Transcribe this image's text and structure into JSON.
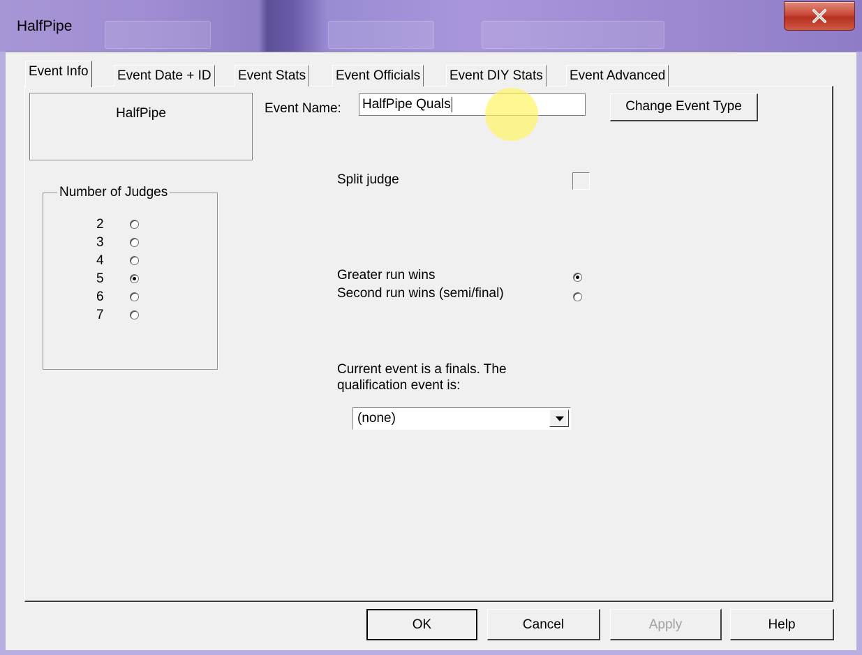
{
  "window": {
    "title": "HalfPipe",
    "close_glyph": "✕"
  },
  "tabs": [
    {
      "label": "Event Info",
      "active": true
    },
    {
      "label": "Event  Date + ID"
    },
    {
      "label": "Event  Stats"
    },
    {
      "label": "Event  Officials"
    },
    {
      "label": "Event DIY Stats"
    },
    {
      "label": "Event Advanced"
    }
  ],
  "event_type_box": {
    "label": "HalfPipe"
  },
  "event_name": {
    "label": "Event Name:",
    "value": "HalfPipe Quals"
  },
  "change_event_type_button": "Change Event Type",
  "number_of_judges": {
    "title": "Number of Judges",
    "options": [
      "2",
      "3",
      "4",
      "5",
      "6",
      "7"
    ],
    "selected": "5"
  },
  "split_judge": {
    "label": "Split judge",
    "checked": false
  },
  "run_rule": {
    "options": [
      "Greater run wins",
      "Second run wins (semi/final)"
    ],
    "selected": "Greater run wins"
  },
  "qualification": {
    "label": "Current event is a finals. The qualification event is:",
    "selected_value": "(none)"
  },
  "footer_buttons": {
    "ok": "OK",
    "cancel": "Cancel",
    "apply": "Apply",
    "help": "Help"
  },
  "colors": {
    "dialog_bg": "#f0f0f0",
    "titlebar": "#a796d6",
    "close_button": "#c9483a",
    "cursor_highlight": "#fff564"
  }
}
